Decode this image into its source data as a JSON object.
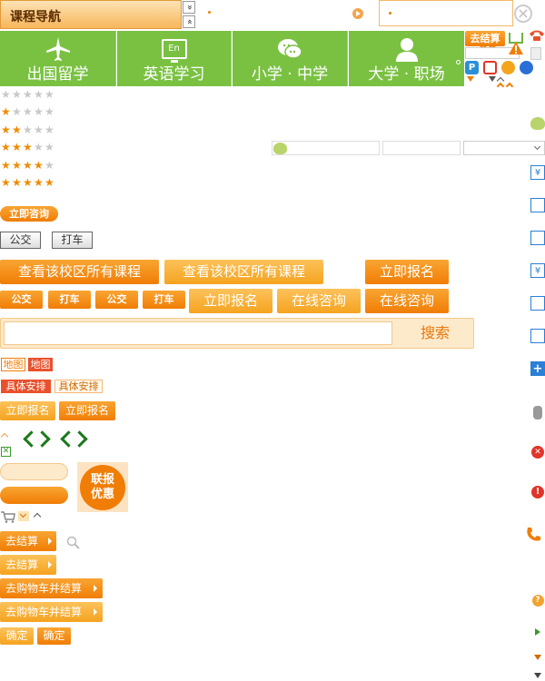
{
  "header": {
    "course_nav": "课程导航",
    "arrow_down": "»",
    "arrow_up": "«",
    "close": "×"
  },
  "nav": {
    "items": [
      {
        "label": "出国留学"
      },
      {
        "label": "英语学习",
        "icon_text": "En"
      },
      {
        "label": "小学 · 中学"
      },
      {
        "label": "大学 · 职场"
      }
    ]
  },
  "right_tools": {
    "checkout": "去结算"
  },
  "ratings": [
    0,
    1,
    2,
    3,
    4,
    5
  ],
  "consult_pill": "立即咨询",
  "transport": {
    "bus": "公交",
    "taxi": "打车"
  },
  "orange_row1": {
    "view_courses_a": "查看该校区所有课程",
    "view_courses_b": "查看该校区所有课程",
    "enroll": "立即报名"
  },
  "orange_row2": {
    "bus_a": "公交",
    "taxi_a": "打车",
    "bus_b": "公交",
    "taxi_b": "打车",
    "enroll": "立即报名",
    "consult_a": "在线咨询",
    "consult_b": "在线咨询"
  },
  "search": {
    "placeholder": "",
    "button": "搜索"
  },
  "map_tags": {
    "map_a": "地图",
    "map_b": "地图"
  },
  "schedule_tags": {
    "schedule_a": "具体安排",
    "schedule_b": "具体安排"
  },
  "enroll_small": {
    "a": "立即报名",
    "b": "立即报名"
  },
  "promo_badge": {
    "line1": "联报",
    "line2": "优惠"
  },
  "checkout_buttons": {
    "a": "去结算",
    "b": "去结算",
    "cart_a": "去购物车并结算",
    "cart_b": "去购物车并结算"
  },
  "confirm": {
    "a": "确定",
    "b": "确定"
  },
  "colors": {
    "nav_green": "#7ac142",
    "orange": "#f07d06",
    "light_orange": "#fcc25a",
    "search_bg": "#fdeacb"
  }
}
